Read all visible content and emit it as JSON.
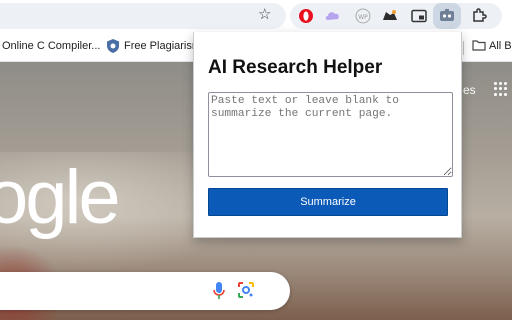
{
  "bookmarks": {
    "items": [
      {
        "label": "Online C Compiler..."
      },
      {
        "label": "Free Plagiarism"
      }
    ],
    "all_label": "All B"
  },
  "page": {
    "logo_text": "ogle",
    "header_link": "es"
  },
  "extensions": {
    "icons": [
      "opera-icon",
      "cloud-icon",
      "wp-icon",
      "hat-icon",
      "pip-icon",
      "research-helper-icon",
      "puzzle-icon"
    ]
  },
  "popup": {
    "title": "AI Research Helper",
    "textarea_placeholder": "Paste text or leave blank to summarize the current page.",
    "textarea_value": "",
    "button_label": "Summarize"
  },
  "colors": {
    "button_bg": "#0b5ab8",
    "toolbar_bg": "#edf1f6"
  }
}
